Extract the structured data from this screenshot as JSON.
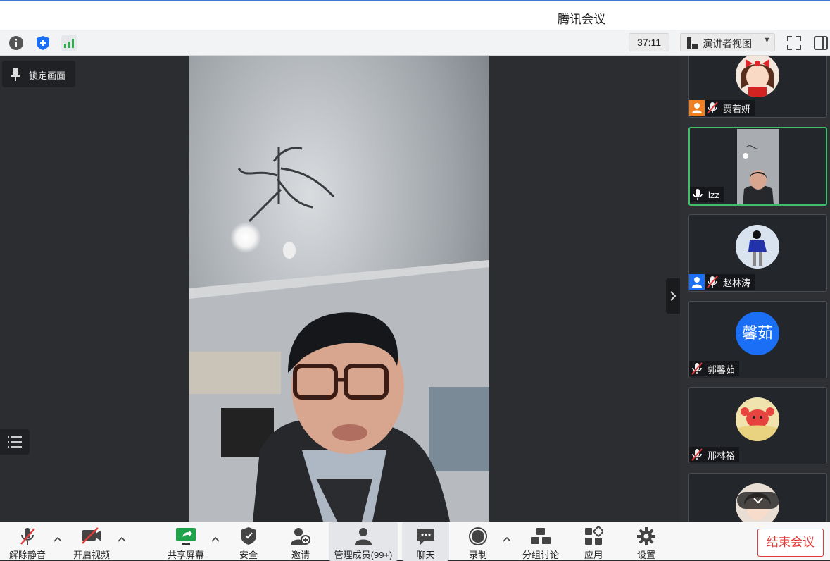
{
  "window": {
    "title": "腾讯会议"
  },
  "topbar": {
    "timer": "37:11",
    "view_label": "演讲者视图"
  },
  "main": {
    "lock_label": "锁定画面"
  },
  "participants": [
    {
      "name": "贾若妍",
      "muted": true,
      "host_badge": "orange"
    },
    {
      "name": "lzz",
      "muted": false,
      "speaking": true
    },
    {
      "name": "赵林涛",
      "muted": true,
      "host_badge": "blue"
    },
    {
      "name": "郭馨茹",
      "muted": true,
      "avatar_text": "馨茹",
      "avatar_color": "#1a6ff5"
    },
    {
      "name": "邢林裕",
      "muted": true
    }
  ],
  "toolbar": {
    "unmute": "解除静音",
    "start_video": "开启视频",
    "share_screen": "共享屏幕",
    "security": "安全",
    "invite": "邀请",
    "manage_members": "管理成员(99+)",
    "chat": "聊天",
    "record": "录制",
    "breakout": "分组讨论",
    "apps": "应用",
    "settings": "设置",
    "end_meeting": "结束会议"
  },
  "colors": {
    "accent_green": "#3fbf6a",
    "end_red": "#e23a3a",
    "shield_blue": "#1a6ff5"
  }
}
